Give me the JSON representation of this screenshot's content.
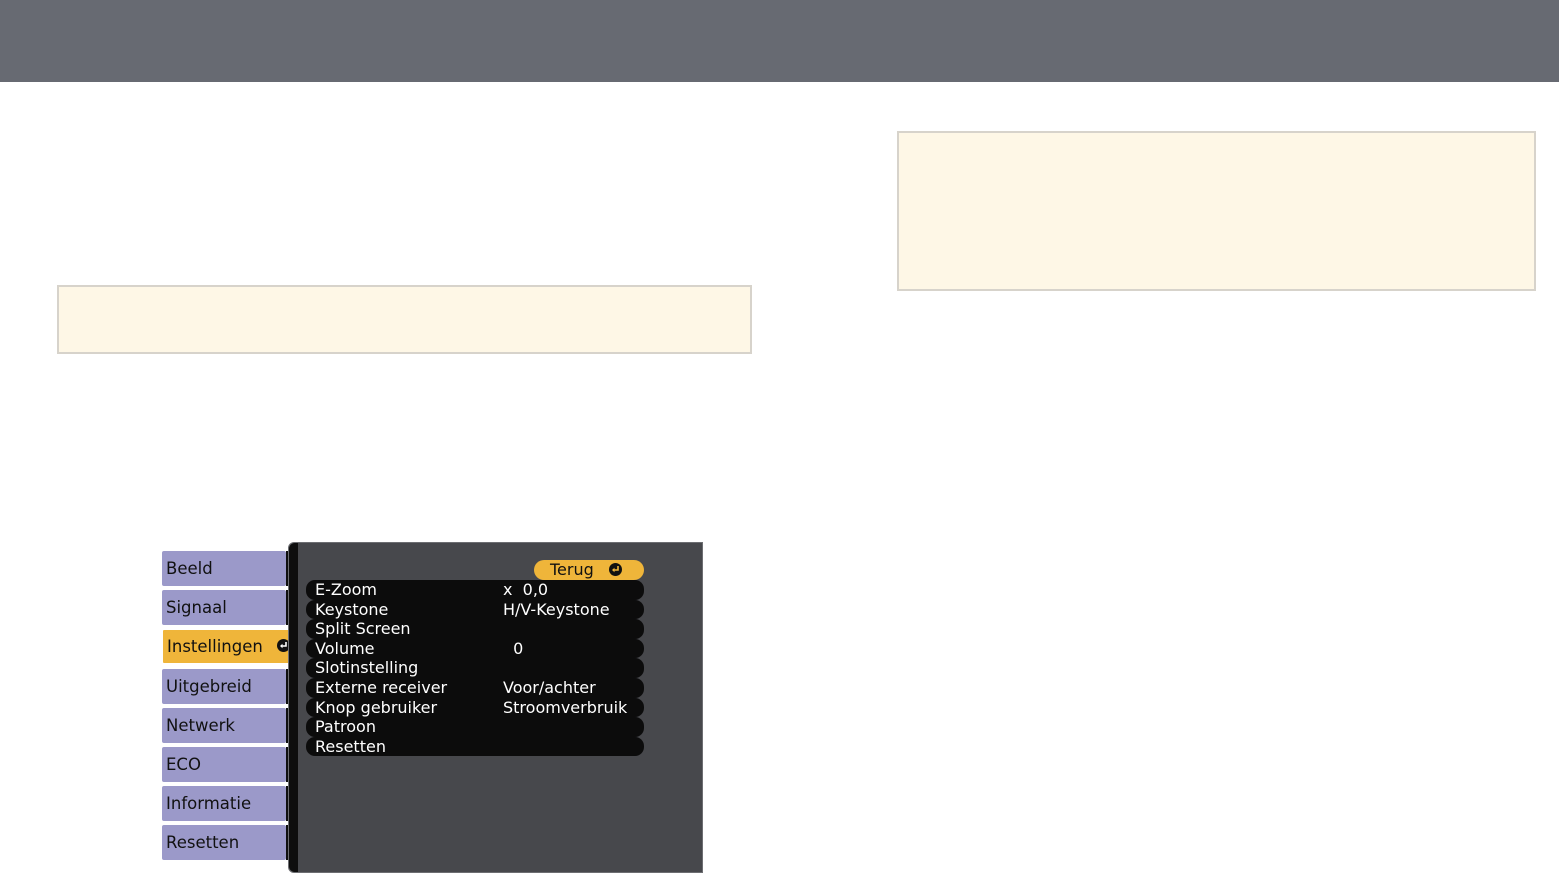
{
  "menu": {
    "tabs": [
      {
        "label": "Beeld"
      },
      {
        "label": "Signaal"
      },
      {
        "label": "Instellingen",
        "active": true
      },
      {
        "label": "Uitgebreid"
      },
      {
        "label": "Netwerk"
      },
      {
        "label": "ECO"
      },
      {
        "label": "Informatie"
      },
      {
        "label": "Resetten"
      }
    ],
    "back_label": "Terug",
    "items": [
      {
        "label": "E-Zoom",
        "value": "x  0,0"
      },
      {
        "label": "Keystone",
        "value": "H/V-Keystone"
      },
      {
        "label": "Split Screen",
        "value": ""
      },
      {
        "label": "Volume",
        "value": "  0"
      },
      {
        "label": "Slotinstelling",
        "value": ""
      },
      {
        "label": "Externe receiver",
        "value": "Voor/achter"
      },
      {
        "label": "Knop gebruiker",
        "value": "Stroomverbruik"
      },
      {
        "label": "Patroon",
        "value": ""
      },
      {
        "label": "Resetten",
        "value": ""
      }
    ]
  },
  "colors": {
    "top_bar": "#676a72",
    "note_background": "#fef7e6",
    "tab_inactive": "#9b99c9",
    "tab_active": "#efb53a",
    "menu_panel": "#47484c",
    "menu_row": "#0c0c0c"
  },
  "icons": {
    "enter": "enter-icon"
  }
}
